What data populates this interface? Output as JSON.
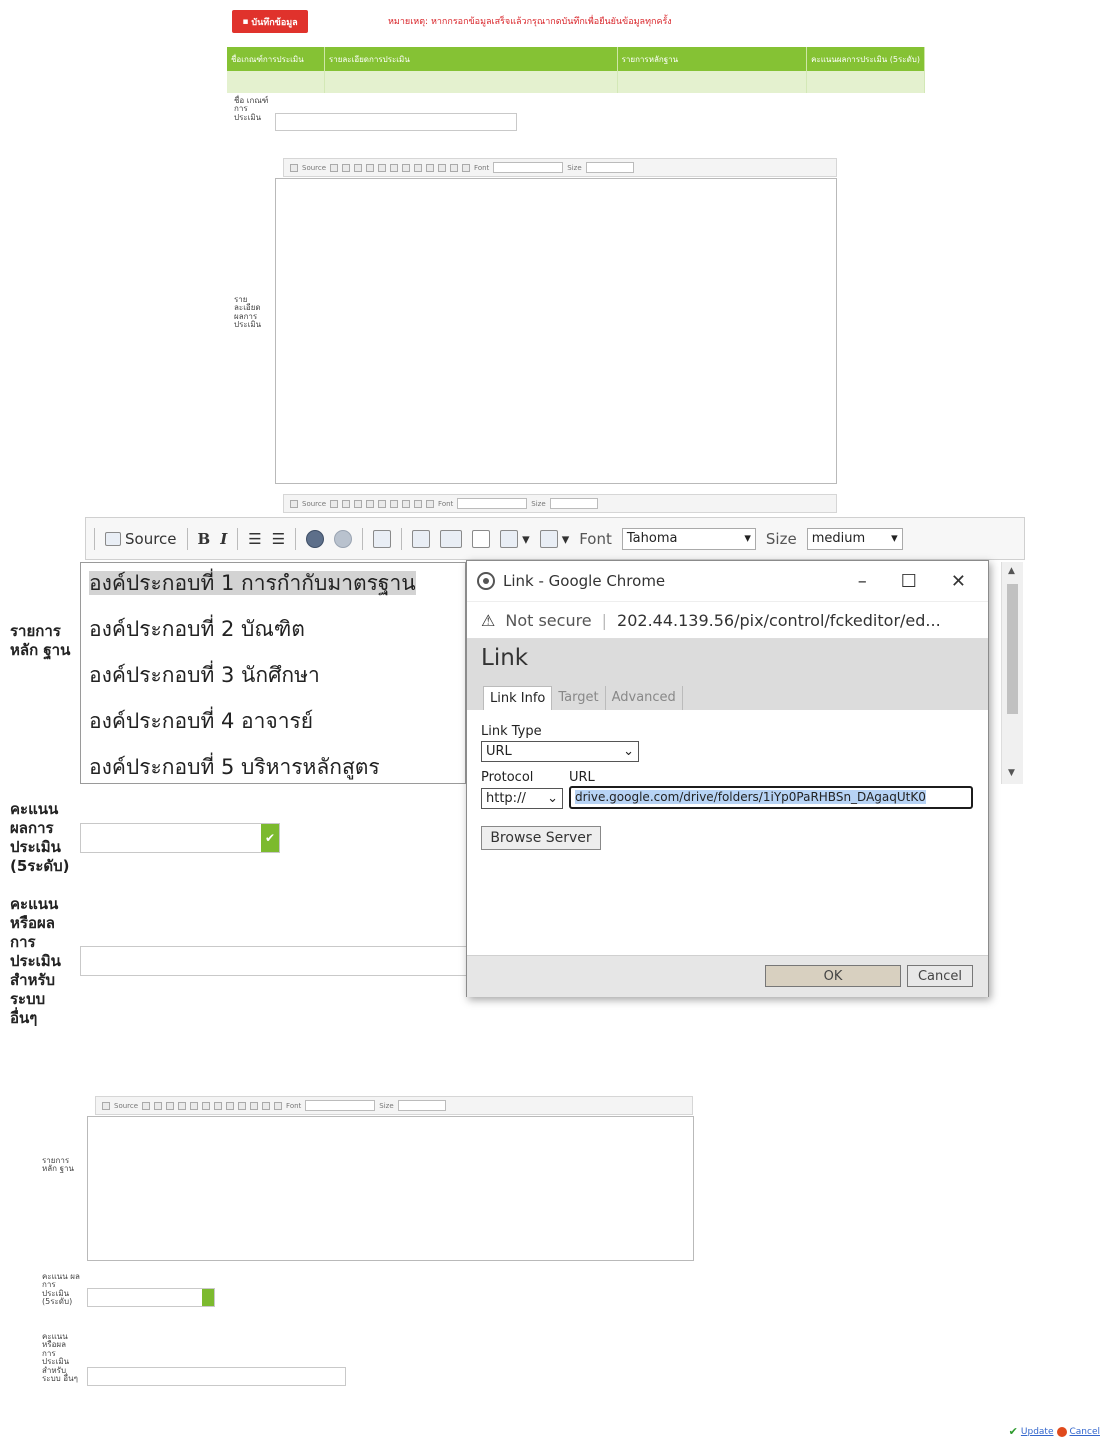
{
  "top": {
    "save_label": "บันทึกข้อมูล",
    "notice": "หมายเหตุ: หากกรอกข้อมูลเสร็จแล้วกรุณากดบันทึกเพื่อยืนยันข้อมูลทุกครั้ง"
  },
  "grid": {
    "columns": [
      "ชื่อเกณฑ์การประเมิน",
      "รายละเอียดการประเมิน",
      "รายการหลักฐาน",
      "คะแนนผลการประเมิน (5ระดับ)"
    ]
  },
  "form_upper": {
    "name_label": "ชื่อ เกณฑ์ การ ประเมิน",
    "detail_label": "รายละเอียด ผลการ ประเมิน"
  },
  "mini_toolbar": {
    "source": "Source",
    "font": "Font",
    "size": "Size"
  },
  "big_toolbar": {
    "source": "Source",
    "bold": "B",
    "italic": "I",
    "font_label": "Font",
    "font_value": "Tahoma",
    "size_label": "Size",
    "size_value": "medium"
  },
  "evidence": {
    "label": "รายการ หลัก ฐาน",
    "items": [
      "องค์ประกอบที่ 1  การกำกับมาตรฐาน",
      "องค์ประกอบที่ 2  บัณฑิต",
      "องค์ประกอบที่ 3  นักศึกษา",
      "องค์ประกอบที่ 4  อาจารย์",
      "องค์ประกอบที่ 5  บริหารหลักสูตร"
    ]
  },
  "score": {
    "label": "คะแนน ผลการ ประเมิน (5ระดับ)",
    "other_label": "คะแนน หรือผล การ ประเมิน สำหรับ ระบบ อื่นๆ"
  },
  "popup": {
    "window_title": "Link - Google Chrome",
    "security": "Not secure",
    "address": "202.44.139.56/pix/control/fckeditor/ed...",
    "dialog_title": "Link",
    "tabs": [
      "Link Info",
      "Target",
      "Advanced"
    ],
    "link_type_label": "Link Type",
    "link_type_value": "URL",
    "protocol_label": "Protocol",
    "protocol_value": "http://",
    "url_label": "URL",
    "url_value": "drive.google.com/drive/folders/1iYp0PaRHBSn_DAgaqUtK0",
    "browse_label": "Browse Server",
    "ok_label": "OK",
    "cancel_label": "Cancel"
  },
  "form_lower": {
    "evidence_label": "รายการ หลัก ฐาน",
    "score_label": "คะแนน ผลการ ประเมิน (5ระดับ)",
    "other_label": "คะแนน หรือผล การ ประเมิน สำหรับ ระบบ อื่นๆ"
  },
  "footer": {
    "update": "Update",
    "cancel": "Cancel"
  },
  "colors": {
    "accent_green": "#85c234",
    "danger_red": "#e0322c",
    "link_blue": "#3366cc"
  }
}
